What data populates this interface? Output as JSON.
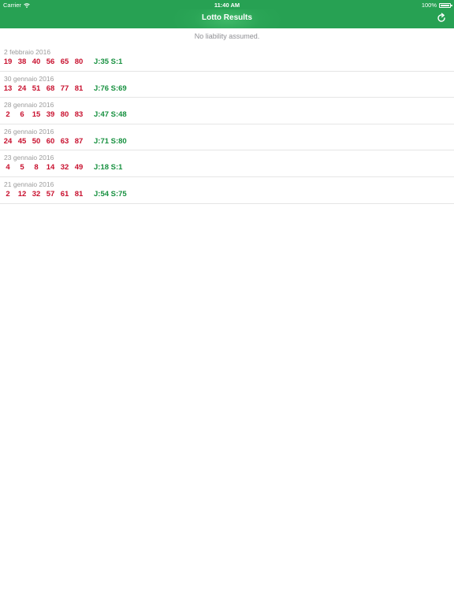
{
  "status_bar": {
    "carrier": "Carrier",
    "time": "11:40 AM",
    "battery": "100%"
  },
  "nav": {
    "title": "Lotto Results",
    "refresh_icon": "refresh-icon"
  },
  "disclaimer": "No liability assumed.",
  "colors": {
    "brand_green": "#27a153",
    "number_red": "#c8102e",
    "extra_green": "#16903f"
  },
  "results": [
    {
      "date": "2 febbraio 2016",
      "numbers": [
        "19",
        "38",
        "40",
        "56",
        "65",
        "80"
      ],
      "extra": "J:35 S:1"
    },
    {
      "date": "30 gennaio 2016",
      "numbers": [
        "13",
        "24",
        "51",
        "68",
        "77",
        "81"
      ],
      "extra": "J:76 S:69"
    },
    {
      "date": "28 gennaio 2016",
      "numbers": [
        "2",
        "6",
        "15",
        "39",
        "80",
        "83"
      ],
      "extra": "J:47 S:48"
    },
    {
      "date": "26 gennaio 2016",
      "numbers": [
        "24",
        "45",
        "50",
        "60",
        "63",
        "87"
      ],
      "extra": "J:71 S:80"
    },
    {
      "date": "23 gennaio 2016",
      "numbers": [
        "4",
        "5",
        "8",
        "14",
        "32",
        "49"
      ],
      "extra": "J:18 S:1"
    },
    {
      "date": "21 gennaio 2016",
      "numbers": [
        "2",
        "12",
        "32",
        "57",
        "61",
        "81"
      ],
      "extra": "J:54 S:75"
    }
  ]
}
